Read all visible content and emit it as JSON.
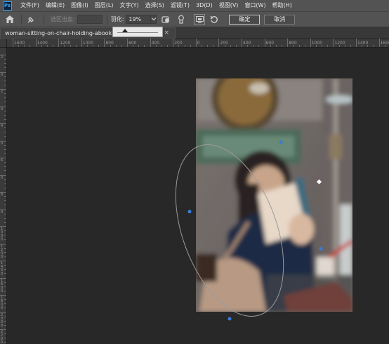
{
  "app": {
    "logo": "Ps"
  },
  "menu": {
    "items": [
      "文件(F)",
      "编辑(E)",
      "图像(I)",
      "图层(L)",
      "文字(Y)",
      "选择(S)",
      "滤镜(T)",
      "3D(D)",
      "视图(V)",
      "窗口(W)",
      "帮助(H)"
    ]
  },
  "options": {
    "selection_output_label": "选区出血:",
    "feather_label": "羽化:",
    "feather_value": "19%",
    "ok_label": "确定",
    "cancel_label": "取消"
  },
  "document": {
    "tab_title": "woman-sitting-on-chair-holding-abook-88905"
  },
  "rulers": {
    "horizontal_labels": [
      "1600",
      "1400",
      "1200",
      "1000",
      "800",
      "600",
      "400",
      "200",
      "0",
      "200",
      "400",
      "600",
      "800",
      "1000",
      "1200",
      "1400",
      "1600"
    ],
    "vertical_labels": [
      "2",
      "0",
      "2",
      "0",
      "4",
      "0",
      "6",
      "0",
      "8",
      "0",
      "1000",
      "1200",
      "1400",
      "1600",
      "1800",
      "2000",
      "2200"
    ]
  },
  "colors": {
    "accent": "#31a8ff",
    "ui_dark": "#282828",
    "ui_panel": "#535353"
  }
}
